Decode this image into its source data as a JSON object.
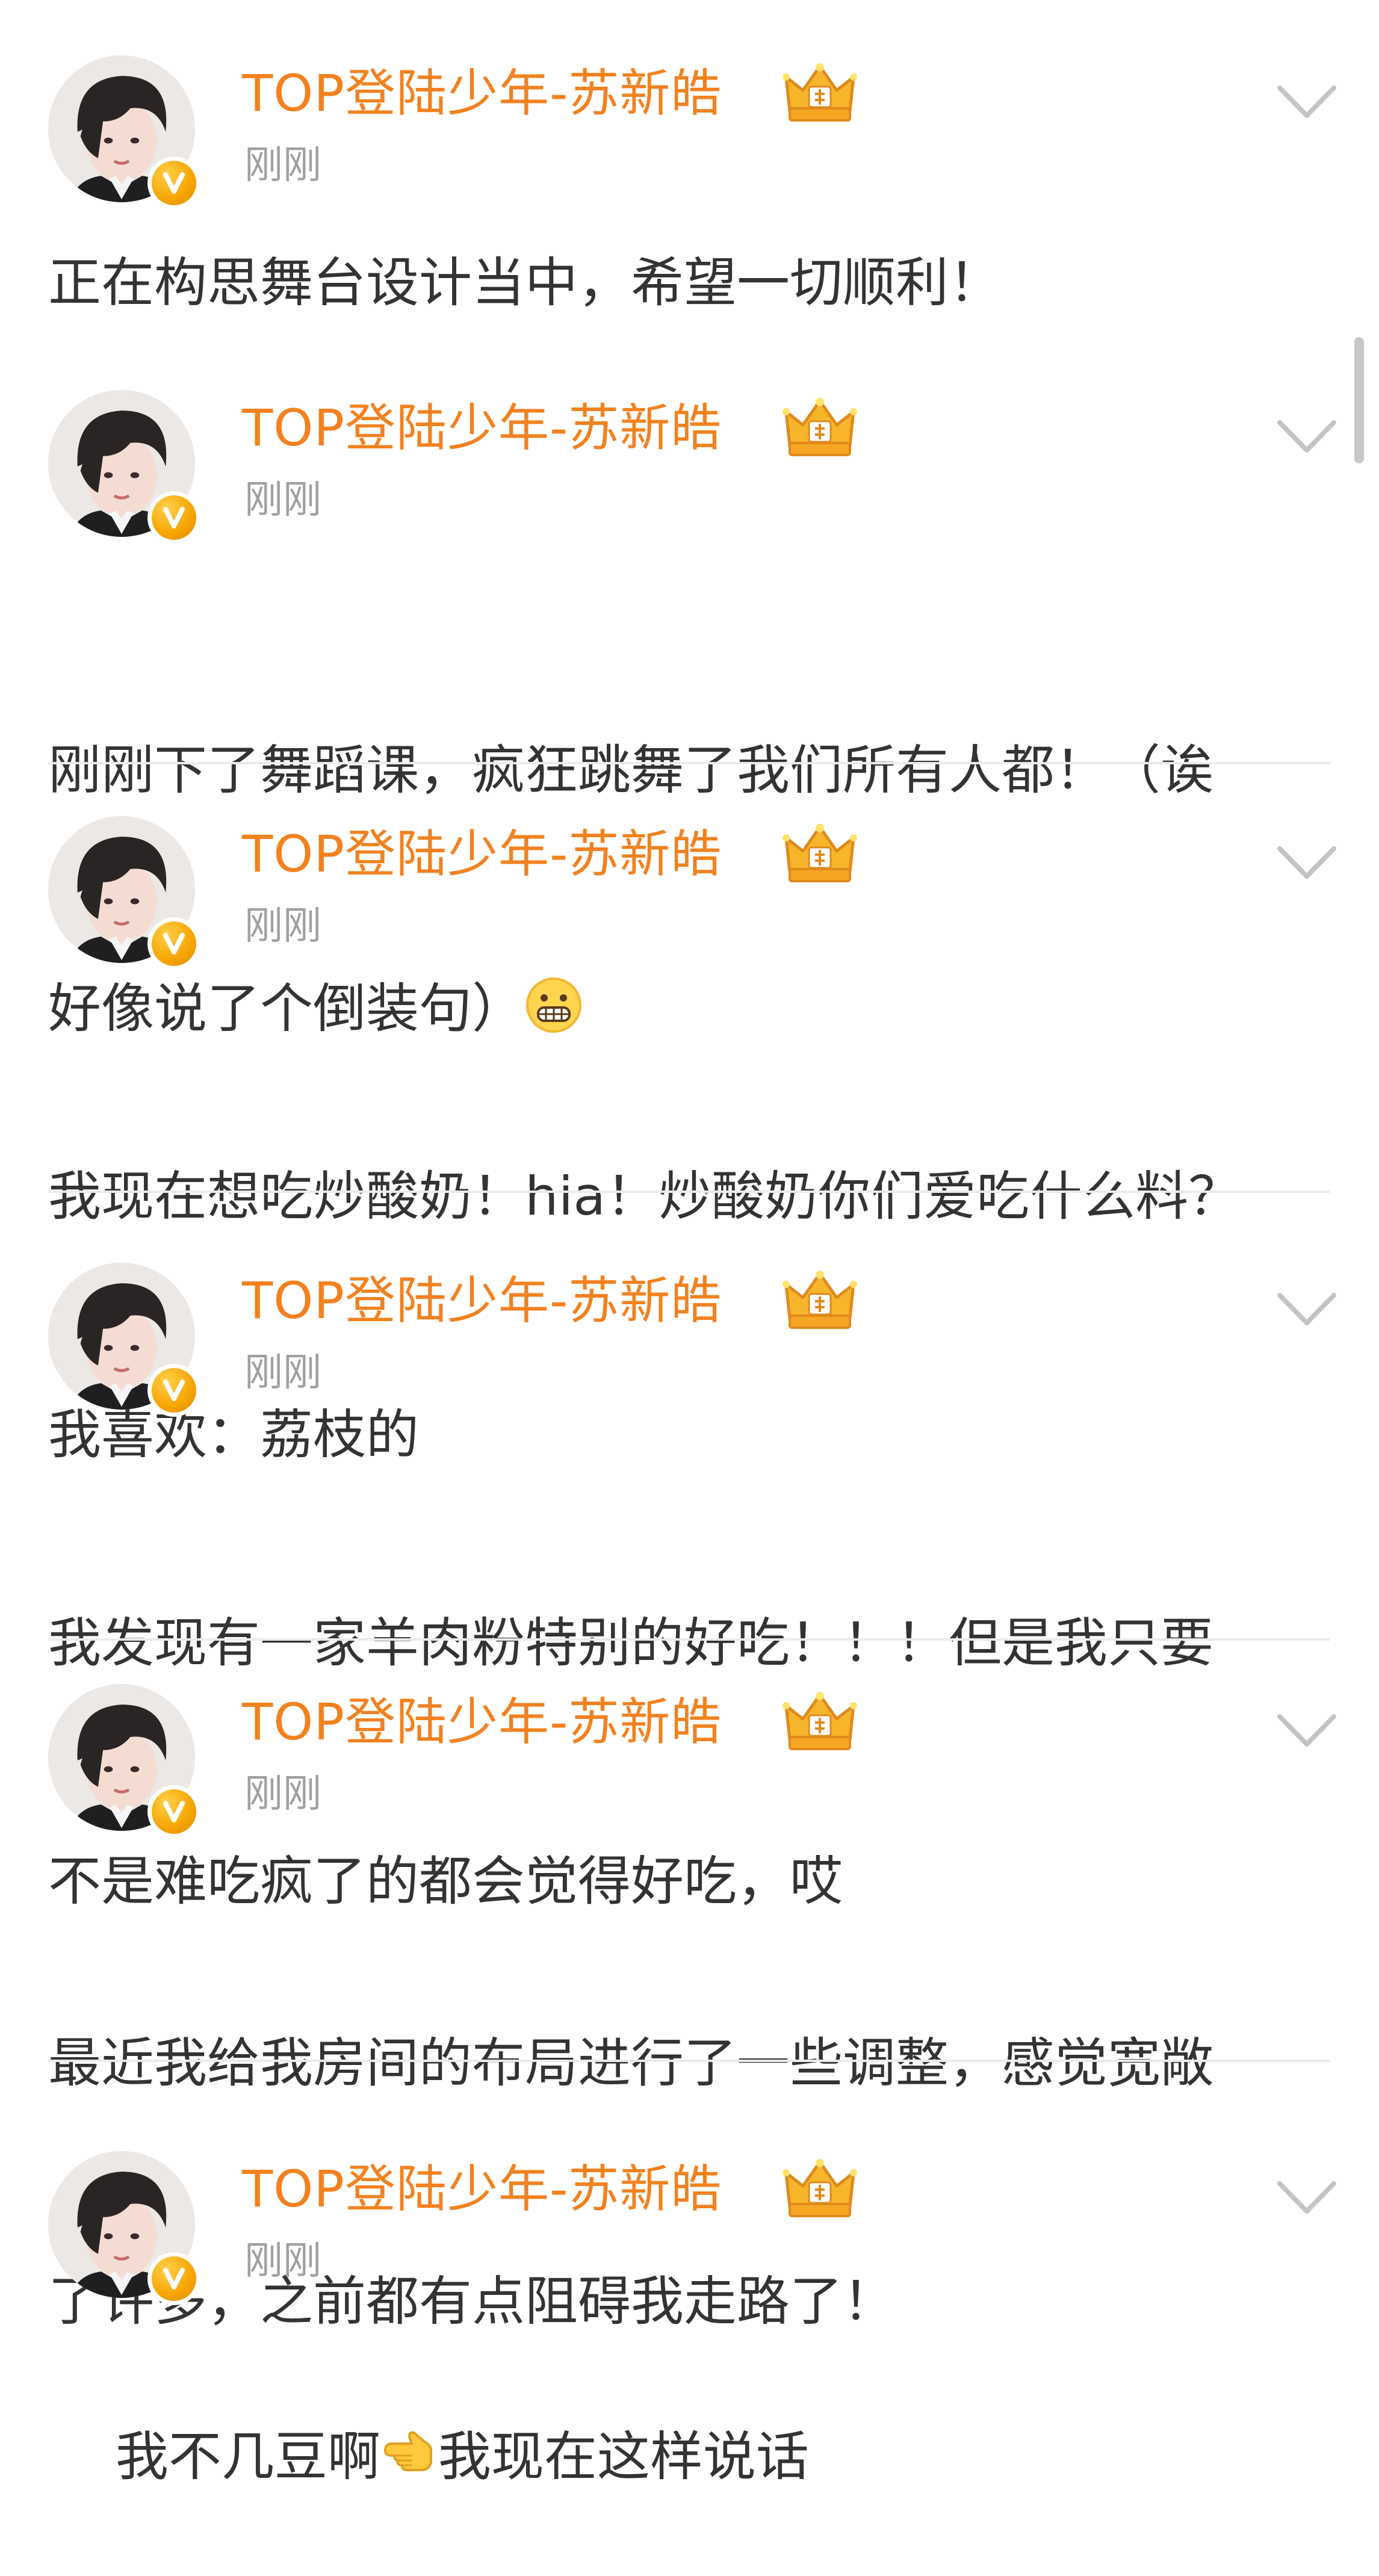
{
  "feed": {
    "posts": [
      {
        "author": "TOP登陆少年-苏新皓",
        "time": "刚刚",
        "text": "正在构思舞台设计当中，希望一切顺利！"
      },
      {
        "author": "TOP登陆少年-苏新皓",
        "time": "刚刚",
        "text_lines": [
          "刚刚下了舞蹈课，疯狂跳舞了我们所有人都！（诶",
          "好像说了个倒装句）"
        ],
        "emoji": "grimacing-face"
      },
      {
        "author": "TOP登陆少年-苏新皓",
        "time": "刚刚",
        "text_lines": [
          "我现在想吃炒酸奶！hia！炒酸奶你们爱吃什么料？",
          "我喜欢：荔枝的"
        ]
      },
      {
        "author": "TOP登陆少年-苏新皓",
        "time": "刚刚",
        "text_lines": [
          "我发现有一家羊肉粉特别的好吃！！！但是我只要",
          "不是难吃疯了的都会觉得好吃，哎"
        ]
      },
      {
        "author": "TOP登陆少年-苏新皓",
        "time": "刚刚",
        "text_lines": [
          "最近我给我房间的布局进行了一些调整，感觉宽敞",
          "了许多，之前都有点阻碍我走路了！"
        ]
      },
      {
        "author": "TOP登陆少年-苏新皓",
        "time": "刚刚",
        "text_before": "我不几豆啊",
        "emoji": "backhand-index-pointing-left",
        "text_after": "我现在这样说话"
      }
    ]
  },
  "colors": {
    "username": "#f2811f",
    "timestamp": "#a0a0a0",
    "body_text": "#333333",
    "divider": "#ebebeb",
    "verified_badge": "#f6a400"
  },
  "icons": {
    "verified": "verified-v-icon",
    "member": "crown-icon",
    "menu": "chevron-down-icon"
  }
}
